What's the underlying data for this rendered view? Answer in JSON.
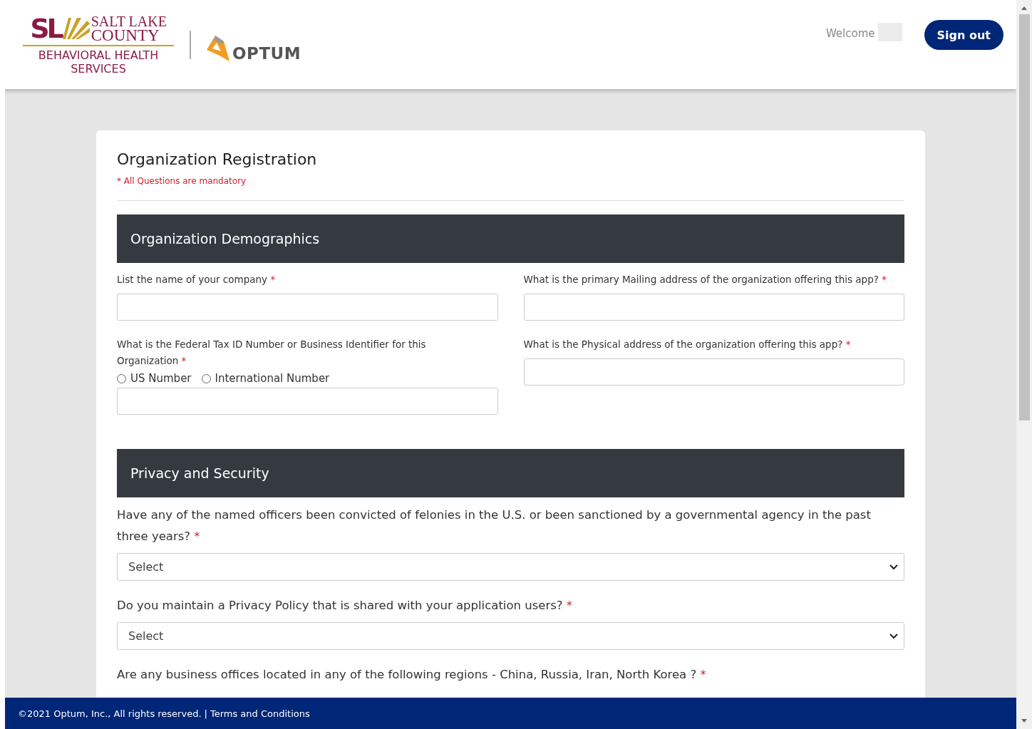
{
  "header": {
    "logo": {
      "mark": "SL",
      "line1": "SALT LAKE",
      "line2": "COUNTY",
      "line3": "BEHAVIORAL HEALTH",
      "line4": "SERVICES"
    },
    "partner_logo": "OPTUM",
    "welcome": "Welcome",
    "sign_out": "Sign out"
  },
  "form": {
    "title": "Organization Registration",
    "note": "* All Questions are mandatory",
    "demographics": {
      "title": "Organization Demographics",
      "left": [
        {
          "kind": "text",
          "label": "List the name of your company",
          "required_mark": "*"
        },
        {
          "kind": "radio-text",
          "label": "What is the Federal Tax ID Number or Business Identifier for this Organization",
          "required_mark": "*",
          "options": [
            {
              "label": "US Number",
              "selected": false
            },
            {
              "label": "International Number",
              "selected": false
            }
          ]
        }
      ],
      "right": [
        {
          "kind": "text",
          "label": "What is the primary Mailing address of the organization offering this app?",
          "required_mark": "*"
        },
        {
          "kind": "text",
          "label": "What is the Physical address of the organization offering this app?",
          "required_mark": "*"
        }
      ]
    },
    "privacy": {
      "title": "Privacy and Security",
      "questions": [
        {
          "text": "Have any of the named officers been convicted of felonies in the U.S. or been sanctioned by a governmental agency in the past three years?",
          "required_mark": "*",
          "select": "Select"
        },
        {
          "text": "Do you maintain a Privacy Policy that is shared with your application users?",
          "required_mark": "*",
          "select": "Select"
        },
        {
          "text": "Are any business offices located in any of the following regions - China, Russia, Iran, North Korea ?",
          "required_mark": "*"
        }
      ]
    }
  },
  "footer": {
    "copyright": "©2021 Optum, Inc., All rights reserved.",
    "separator": "|",
    "link": "Terms and Conditions"
  }
}
